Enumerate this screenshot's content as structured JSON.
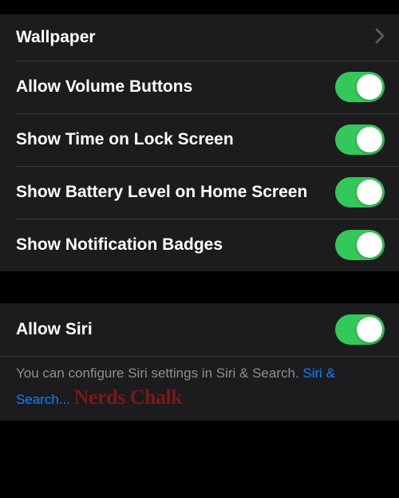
{
  "section1": {
    "items": [
      {
        "label": "Wallpaper",
        "type": "nav"
      },
      {
        "label": "Allow Volume Buttons",
        "type": "toggle",
        "value": true
      },
      {
        "label": "Show Time on Lock Screen",
        "type": "toggle",
        "value": true
      },
      {
        "label": "Show Battery Level on Home Screen",
        "type": "toggle",
        "value": true
      },
      {
        "label": "Show Notification Badges",
        "type": "toggle",
        "value": true
      }
    ]
  },
  "section2": {
    "items": [
      {
        "label": "Allow Siri",
        "type": "toggle",
        "value": true
      }
    ],
    "footer": {
      "text": "You can configure Siri settings in Siri & Search. ",
      "linkText": "Siri & Search..."
    }
  },
  "watermark": "Nerds Chalk"
}
